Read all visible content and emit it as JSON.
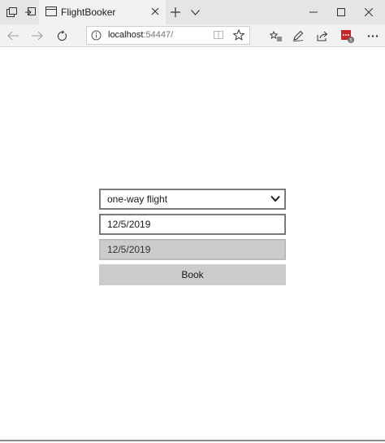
{
  "browser": {
    "tab": {
      "title": "FlightBooker"
    },
    "address": {
      "host": "localhost",
      "port": ":54447/"
    },
    "icons": {
      "tab_actions": "tab-actions-icon",
      "set_aside": "set-aside-tabs-icon",
      "new_tab": "plus-icon",
      "tab_list": "chevron-down-icon",
      "minimize": "minimize-icon",
      "maximize": "maximize-icon",
      "close": "close-icon",
      "back": "back-arrow-icon",
      "forward": "forward-arrow-icon",
      "refresh": "refresh-icon",
      "favorites": "favorites-icon",
      "notes": "pen-icon",
      "share": "share-icon",
      "extension": "extension-icon",
      "more": "ellipsis-icon"
    },
    "extension_badge": "5"
  },
  "form": {
    "flight_type": {
      "selected": "one-way flight"
    },
    "start_date": {
      "value": "12/5/2019"
    },
    "return_date": {
      "value": "12/5/2019",
      "disabled": true
    },
    "book_label": "Book"
  },
  "colors": {
    "chrome_bg": "#e5e5e5",
    "tab_bg": "#f2f2f2",
    "field_border": "#7a7a7a",
    "disabled_bg": "#cccccc",
    "extension_red": "#c4262e"
  }
}
